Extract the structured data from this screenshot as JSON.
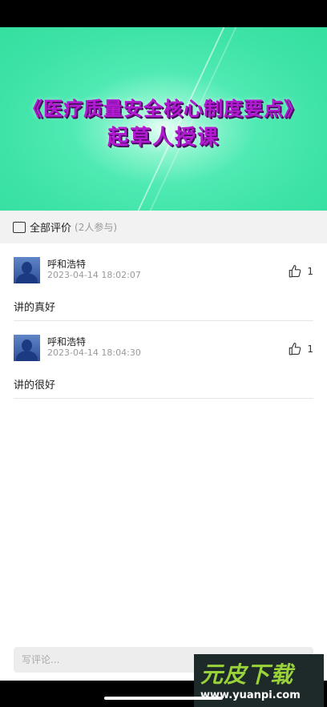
{
  "video": {
    "title_line1": "《医疗质量安全核心制度要点》",
    "title_line2": "起草人授课"
  },
  "comments_header": {
    "title": "全部评价",
    "count": "(2人参与)"
  },
  "comments": [
    {
      "name": "呼和浩特",
      "time": "2023-04-14 18:02:07",
      "likes": "1",
      "text": "讲的真好"
    },
    {
      "name": "呼和浩特",
      "time": "2023-04-14 18:04:30",
      "likes": "1",
      "text": "讲的很好"
    }
  ],
  "input": {
    "placeholder": "写评论..."
  },
  "watermark": {
    "logo": "元皮下载",
    "url": "www.yuanpi.com"
  }
}
